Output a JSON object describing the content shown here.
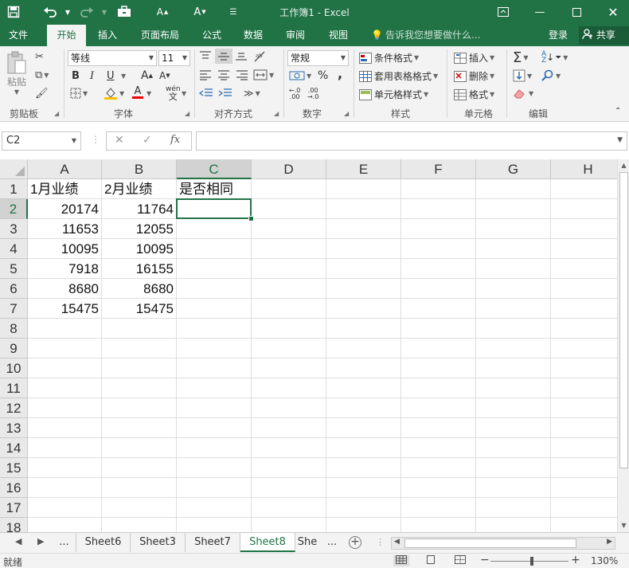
{
  "titlebar": {
    "title": "工作簿1 - Excel",
    "icons": [
      "save-icon",
      "undo-icon",
      "redo-icon",
      "touch-mode-icon",
      "increase-font-icon",
      "decrease-font-icon",
      "customize-qat-icon"
    ]
  },
  "tabs": [
    {
      "label": "文件"
    },
    {
      "label": "开始"
    },
    {
      "label": "插入"
    },
    {
      "label": "页面布局"
    },
    {
      "label": "公式"
    },
    {
      "label": "数据"
    },
    {
      "label": "审阅"
    },
    {
      "label": "视图"
    }
  ],
  "active_tab": "开始",
  "tellme": "告诉我您想要做什么...",
  "login": "登录",
  "share": "共享",
  "ribbon": {
    "clipboard": {
      "label": "剪贴板",
      "paste": "粘贴"
    },
    "font": {
      "label": "字体",
      "name": "等线",
      "size": "11",
      "bold": "B",
      "italic": "I",
      "underline": "U",
      "phonetic": "wén"
    },
    "alignment": {
      "label": "对齐方式"
    },
    "number": {
      "label": "数字",
      "format": "常规",
      "percent": "%",
      "comma": ","
    },
    "styles": {
      "label": "样式",
      "conditional": "条件格式",
      "table": "套用表格格式",
      "cell": "单元格样式"
    },
    "cells": {
      "label": "单元格",
      "insert": "插入",
      "delete": "删除",
      "format": "格式"
    },
    "editing": {
      "label": "编辑"
    }
  },
  "formula_bar": {
    "name_box": "C2",
    "formula": ""
  },
  "grid": {
    "columns": [
      "A",
      "B",
      "C",
      "D",
      "E",
      "F",
      "G",
      "H"
    ],
    "rows": [
      "1",
      "2",
      "3",
      "4",
      "5",
      "6",
      "7",
      "8",
      "9",
      "10",
      "11",
      "12",
      "13",
      "14",
      "15",
      "16",
      "17",
      "18"
    ],
    "cells": {
      "A1": "1月业绩",
      "B1": "2月业绩",
      "C1": "是否相同",
      "A2": "20174",
      "B2": "11764",
      "A3": "11653",
      "B3": "12055",
      "A4": "10095",
      "B4": "10095",
      "A5": "7918",
      "B5": "16155",
      "A6": "8680",
      "B6": "8680",
      "A7": "15475",
      "B7": "15475"
    },
    "selected": "C2"
  },
  "sheets": {
    "ellipsis": "...",
    "tabs": [
      "Sheet6",
      "Sheet3",
      "Sheet7",
      "Sheet8",
      "She"
    ],
    "more": "...",
    "active": "Sheet8"
  },
  "status": {
    "ready": "就绪",
    "zoom": "130%"
  },
  "colors": {
    "accent": "#217346"
  }
}
